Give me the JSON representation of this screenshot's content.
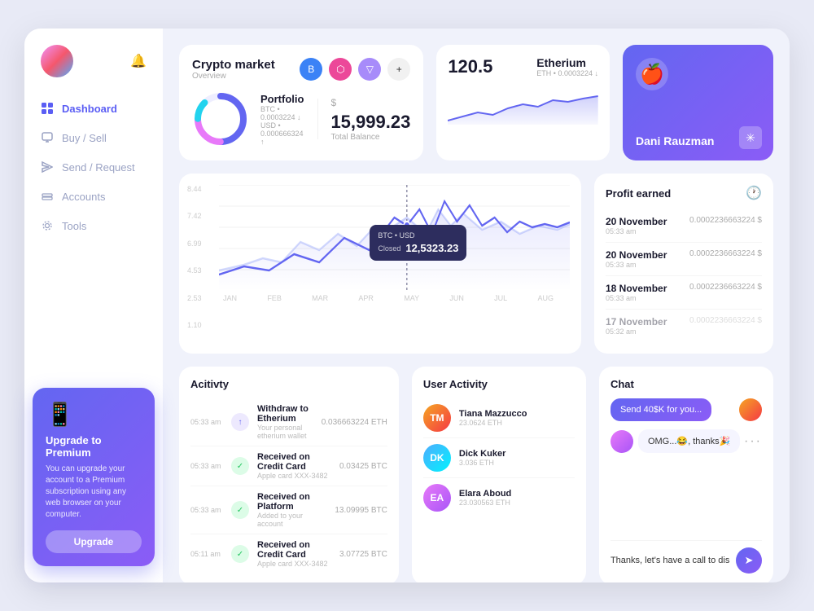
{
  "sidebar": {
    "nav_items": [
      {
        "label": "Dashboard",
        "icon": "grid",
        "active": true
      },
      {
        "label": "Buy / Sell",
        "icon": "monitor",
        "active": false
      },
      {
        "label": "Send / Request",
        "icon": "send",
        "active": false
      },
      {
        "label": "Accounts",
        "icon": "layers",
        "active": false
      },
      {
        "label": "Tools",
        "icon": "settings",
        "active": false
      }
    ]
  },
  "upgrade_card": {
    "title": "Upgrade to Premium",
    "description": "You can upgrade your account to a Premium subscription using any web browser on your computer.",
    "button_label": "Upgrade"
  },
  "crypto_market": {
    "title": "Crypto market",
    "subtitle": "Overview",
    "portfolio": {
      "title": "Portfolio",
      "btc": "BTC • 0.0003224 ↓",
      "usd": "USD • 0.000666324 ↑",
      "balance_symbol": "$",
      "balance": "15,999.23",
      "balance_label": "Total Balance"
    },
    "etherium": {
      "title": "Etherium",
      "subtitle": "ETH • 0.0003224 ↓",
      "value": "120.5"
    }
  },
  "profile_card": {
    "user_name": "Dani Rauzman"
  },
  "chart": {
    "y_labels": [
      "8.44",
      "7.42",
      "6.99",
      "4.53",
      "2.53",
      "1.10"
    ],
    "x_labels": [
      "JAN",
      "FEB",
      "MAR",
      "APR",
      "MAY",
      "JUN",
      "JUL",
      "AUG"
    ],
    "tooltip": {
      "label": "BTC • USD",
      "status": "Closed",
      "value": "12,5323.23"
    }
  },
  "profit": {
    "title": "Profit earned",
    "rows": [
      {
        "date": "20 November",
        "time": "05:33 am",
        "amount": "0.0002236663224 $",
        "faded": false
      },
      {
        "date": "20 November",
        "time": "05:33 am",
        "amount": "0.0002236663224 $",
        "faded": false
      },
      {
        "date": "18 November",
        "time": "05:33 am",
        "amount": "0.0002236663224 $",
        "faded": false
      },
      {
        "date": "17 November",
        "time": "05:32 am",
        "amount": "0.0002236663224 $",
        "faded": true
      }
    ]
  },
  "activity": {
    "title": "Acitivty",
    "rows": [
      {
        "time": "05:33 am",
        "title": "Withdraw to Etherium",
        "subtitle": "Your personal etherium wallet",
        "amount": "0.036663224 ETH",
        "color": "#6366f1",
        "icon": "↑"
      },
      {
        "time": "05:33 am",
        "title": "Received on Credit Card",
        "subtitle": "Apple card XXX-3482",
        "amount": "0.03425 BTC",
        "color": "#22c55e",
        "icon": "✓"
      },
      {
        "time": "05:33 am",
        "title": "Received on Platform",
        "subtitle": "Added to your account",
        "amount": "13.09995 BTC",
        "color": "#22c55e",
        "icon": "✓"
      },
      {
        "time": "05:11 am",
        "title": "Received on Credit Card",
        "subtitle": "Apple card XXX-3482",
        "amount": "3.07725 BTC",
        "color": "#22c55e",
        "icon": "✓"
      }
    ]
  },
  "user_activity": {
    "title": "User Activity",
    "users": [
      {
        "name": "Tiana Mazzucco",
        "amount": "23.0624  ETH",
        "color": "#f5a623",
        "initials": "TM"
      },
      {
        "name": "Dick Kuker",
        "amount": "3.036  ETH",
        "color": "#4facfe",
        "initials": "DK"
      },
      {
        "name": "Elara Aboud",
        "amount": "23.030563  ETH",
        "color": "#e879f9",
        "initials": "EA"
      }
    ]
  },
  "chat": {
    "title": "Chat",
    "messages": [
      {
        "text": "Send 40$K for you...",
        "type": "sent"
      },
      {
        "text": "OMG...😂, thanks🎉",
        "type": "received"
      }
    ],
    "input_placeholder": "Thanks, let's have a call to discuss...",
    "input_value": "Thanks, let's have a call to discuss...",
    "send_label": "➤"
  }
}
